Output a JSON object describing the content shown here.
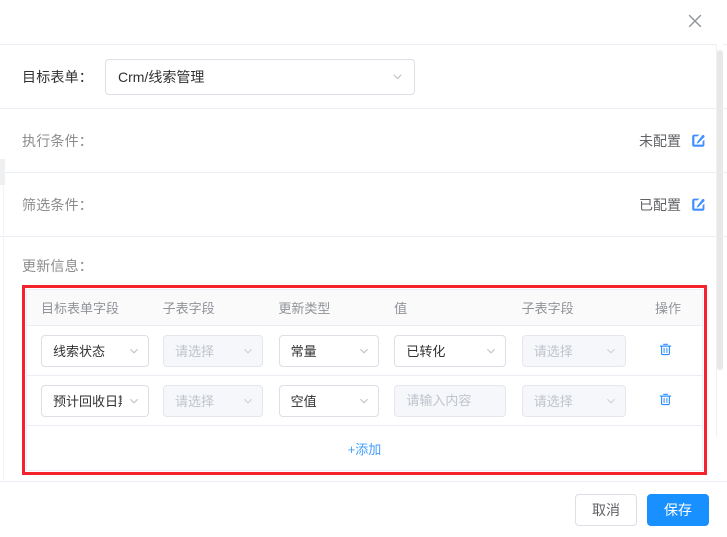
{
  "dialog": {
    "close_icon": "close-icon"
  },
  "target_form": {
    "label": "目标表单：",
    "value": "Crm/线索管理",
    "chevron_icon": "chevron-down-icon"
  },
  "conditions": [
    {
      "label": "执行条件：",
      "status": "未配置",
      "edit_icon": "edit-pencil-icon"
    },
    {
      "label": "筛选条件：",
      "status": "已配置",
      "edit_icon": "edit-pencil-icon"
    }
  ],
  "update_info": {
    "label": "更新信息：",
    "highlight_color": "#f5222d",
    "columns": [
      "目标表单字段",
      "子表字段",
      "更新类型",
      "值",
      "子表字段",
      "操作"
    ],
    "rows": [
      {
        "target_field": {
          "value": "线索状态",
          "disabled": false
        },
        "sub_field_1": {
          "value": "请选择",
          "disabled": true
        },
        "update_type": {
          "value": "常量",
          "disabled": false
        },
        "value_field": {
          "value": "已转化",
          "disabled": false,
          "type": "select"
        },
        "sub_field_2": {
          "value": "请选择",
          "disabled": true
        },
        "delete_icon": "trash-icon"
      },
      {
        "target_field": {
          "value": "预计回收日期",
          "disabled": false
        },
        "sub_field_1": {
          "value": "请选择",
          "disabled": true
        },
        "update_type": {
          "value": "空值",
          "disabled": false
        },
        "value_field": {
          "value": "请输入内容",
          "disabled": true,
          "type": "input"
        },
        "sub_field_2": {
          "value": "请选择",
          "disabled": true
        },
        "delete_icon": "trash-icon"
      }
    ],
    "add_label": "+添加",
    "add_color": "#409eff"
  },
  "footer": {
    "cancel_label": "取消",
    "save_label": "保存",
    "save_color": "#1890ff"
  }
}
